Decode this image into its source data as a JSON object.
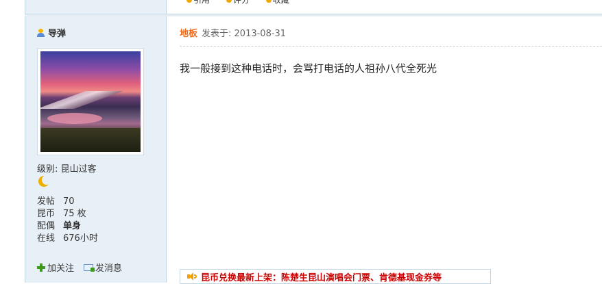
{
  "topbar": {
    "items": [
      "引用",
      "评分",
      "收藏"
    ]
  },
  "author": {
    "name": "导弹"
  },
  "profile": {
    "level_label": "级别:",
    "level_value": "昆山过客",
    "stats": [
      {
        "key": "发帖",
        "value": "70",
        "bold": false
      },
      {
        "key": "昆币",
        "value": "75 枚",
        "bold": false
      },
      {
        "key": "配偶",
        "value": "单身",
        "bold": true
      },
      {
        "key": "在线",
        "value": "676小时",
        "bold": false
      }
    ],
    "follow_label": "加关注",
    "message_label": "发消息"
  },
  "post": {
    "floor": "地板",
    "posted_on": "发表于: 2013-08-31",
    "content": "我一般接到这种电话时，会骂打电话的人祖孙八代全死光"
  },
  "notice": {
    "text": "昆币兑换最新上架：陈楚生昆山演唱会门票、肯德基现金券等"
  },
  "icons": [
    "user-icon",
    "moon-icon",
    "plus-icon",
    "mail-icon",
    "speaker-icon"
  ],
  "colors": {
    "floor": "#f26c1a",
    "notice": "#cc0000",
    "sidebar_bg": "#e8f0f7",
    "border": "#c2d5e3"
  }
}
